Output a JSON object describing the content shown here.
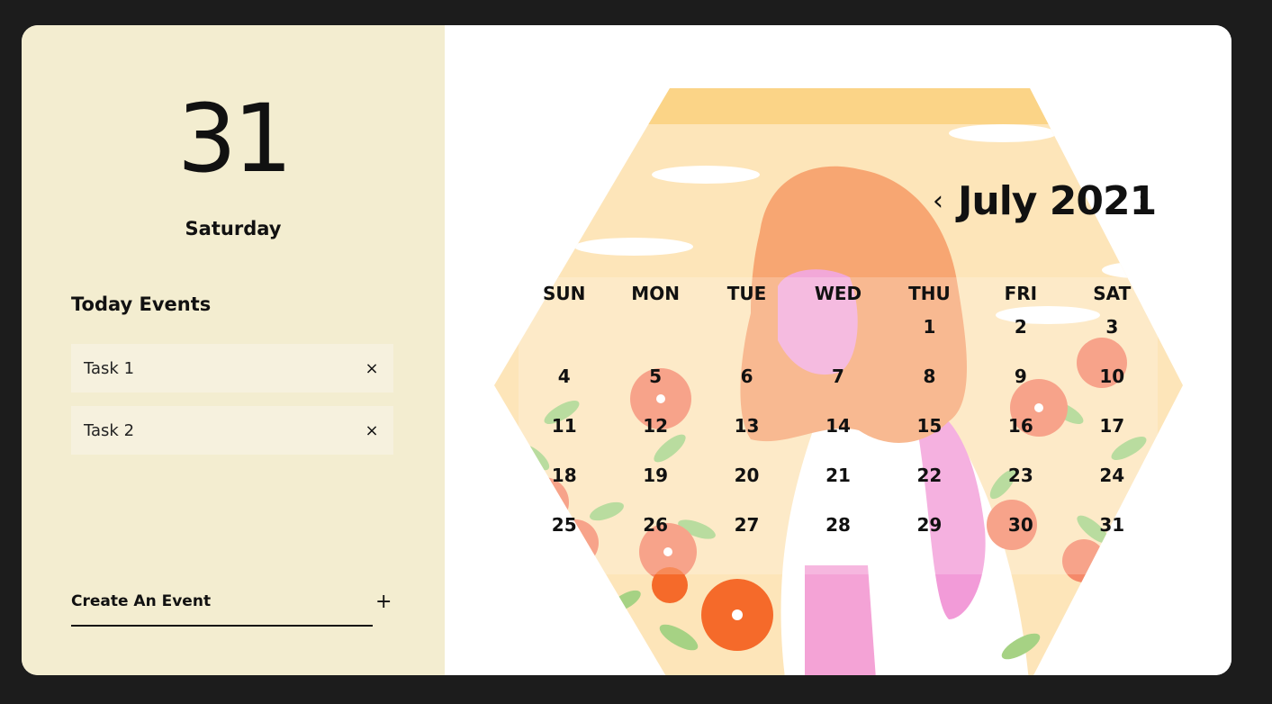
{
  "selected": {
    "day_number": "31",
    "weekday": "Saturday"
  },
  "events": {
    "title": "Today Events",
    "items": [
      {
        "label": "Task 1",
        "remove_icon": "×"
      },
      {
        "label": "Task 2",
        "remove_icon": "×"
      }
    ]
  },
  "create": {
    "label": "Create An Event",
    "add_icon": "+"
  },
  "calendar": {
    "month_title": "July 2021",
    "prev_icon": "‹",
    "next_icon": "›",
    "weekdays": [
      "SUN",
      "MON",
      "TUE",
      "WED",
      "THU",
      "FRI",
      "SAT"
    ],
    "weeks": [
      [
        "",
        "",
        "",
        "",
        "1",
        "2",
        "3"
      ],
      [
        "4",
        "5",
        "6",
        "7",
        "8",
        "9",
        "10"
      ],
      [
        "11",
        "12",
        "13",
        "14",
        "15",
        "16",
        "17"
      ],
      [
        "18",
        "19",
        "20",
        "21",
        "22",
        "23",
        "24"
      ],
      [
        "25",
        "26",
        "27",
        "28",
        "29",
        "30",
        "31"
      ]
    ]
  },
  "colors": {
    "left_panel": "#f3edd0",
    "background": "#1c1c1c",
    "accent_orange": "#f5a56e"
  }
}
